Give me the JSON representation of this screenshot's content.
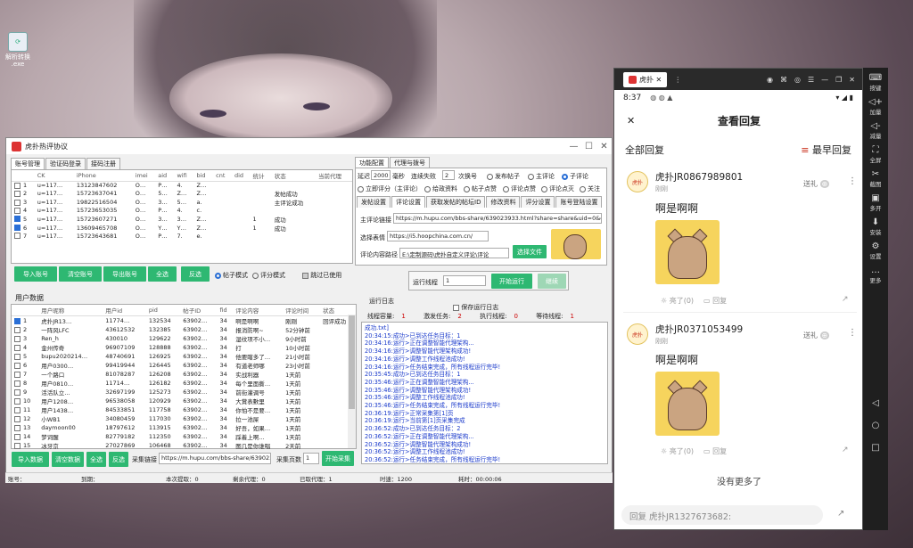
{
  "desktop": {
    "icon_label": "解析转换\n.exe"
  },
  "window": {
    "title": "虎扑热评协议"
  },
  "account_tabs": [
    "账号管理",
    "验证码登录",
    "接码注册"
  ],
  "account_table": {
    "headers": [
      "",
      "CK",
      "iPhone",
      "imei",
      "aid",
      "wifi",
      "bid",
      "cnt",
      "did",
      "统计",
      "状态",
      "当前代理"
    ],
    "rows": [
      {
        "n": "1",
        "checked": false,
        "ck": "u=117…",
        "iphone": "13123847602",
        "imei": "O…",
        "aid": "P…",
        "wifi": "4.",
        "bid": "Z…",
        "cnt": "",
        "did": "",
        "stat": "",
        "status": ""
      },
      {
        "n": "2",
        "checked": false,
        "ck": "u=117…",
        "iphone": "15723637041",
        "imei": "O…",
        "aid": "5…",
        "wifi": "Z…",
        "bid": "Z…",
        "cnt": "",
        "did": "",
        "stat": "",
        "status": "发帖成功"
      },
      {
        "n": "3",
        "checked": false,
        "ck": "u=117…",
        "iphone": "19822516504",
        "imei": "O…",
        "aid": "3…",
        "wifi": "5…",
        "bid": "a.",
        "cnt": "",
        "did": "",
        "stat": "",
        "status": "主评论成功"
      },
      {
        "n": "4",
        "checked": false,
        "ck": "u=117…",
        "iphone": "15723653035",
        "imei": "O…",
        "aid": "P…",
        "wifi": "4.",
        "bid": "c.",
        "cnt": "",
        "did": "",
        "stat": "",
        "status": ""
      },
      {
        "n": "5",
        "checked": true,
        "ck": "u=117…",
        "iphone": "15723607271",
        "imei": "O…",
        "aid": "3…",
        "wifi": "3…",
        "bid": "Z…",
        "cnt": "",
        "did": "",
        "stat": "1",
        "status": "成功"
      },
      {
        "n": "6",
        "checked": true,
        "ck": "u=117…",
        "iphone": "13609465708",
        "imei": "O…",
        "aid": "Y…",
        "wifi": "Y…",
        "bid": "Z…",
        "cnt": "",
        "did": "",
        "stat": "1",
        "status": "成功"
      },
      {
        "n": "7",
        "checked": false,
        "ck": "u=117…",
        "iphone": "15723643681",
        "imei": "O…",
        "aid": "P…",
        "wifi": "7.",
        "bid": "e.",
        "cnt": "",
        "did": "",
        "stat": "",
        "status": ""
      }
    ]
  },
  "account_buttons": {
    "import": "导入账号",
    "clear": "清空账号",
    "export": "导出账号",
    "select_all": "全选",
    "invert": "反选"
  },
  "mode": {
    "post": "帖子模式",
    "comment": "评分模式",
    "skip": "跳过已使用"
  },
  "user_section_title": "用户数据",
  "user_table": {
    "headers": [
      "",
      "用户昵称",
      "用户id",
      "pid",
      "帖子ID",
      "fid",
      "评论内容",
      "评论时间",
      "状态"
    ],
    "rows": [
      {
        "n": "1",
        "checked": true,
        "name": "虎扑JR13…",
        "uid": "11774…",
        "pid": "132534",
        "tid": "63902…",
        "fid": "34",
        "content": "啊是啊啊",
        "time": "刚刚",
        "status": "回评成功"
      },
      {
        "n": "2",
        "checked": false,
        "name": "一阵风LFC",
        "uid": "43612532",
        "pid": "132385",
        "tid": "63902…",
        "fid": "34",
        "content": "报消防啊~",
        "time": "52分钟前",
        "status": ""
      },
      {
        "n": "3",
        "checked": false,
        "name": "Ren_h",
        "uid": "430010",
        "pid": "129622",
        "tid": "63902…",
        "fid": "34",
        "content": "湿纹项不小…",
        "time": "9小时前",
        "status": ""
      },
      {
        "n": "4",
        "checked": false,
        "name": "金州传奇",
        "uid": "96907109",
        "pid": "128888",
        "tid": "63902…",
        "fid": "34",
        "content": "打",
        "time": "10小时前",
        "status": ""
      },
      {
        "n": "5",
        "checked": false,
        "name": "bupu2020214…",
        "uid": "48740691",
        "pid": "126925",
        "tid": "63902…",
        "fid": "34",
        "content": "他要瞎多了…",
        "time": "21小时前",
        "status": ""
      },
      {
        "n": "6",
        "checked": false,
        "name": "用户0300…",
        "uid": "99419944",
        "pid": "126445",
        "tid": "63902…",
        "fid": "34",
        "content": "有道老师哪",
        "time": "23小时前",
        "status": ""
      },
      {
        "n": "7",
        "checked": false,
        "name": "一个路口",
        "uid": "81078287",
        "pid": "126208",
        "tid": "63902…",
        "fid": "34",
        "content": "实战利器",
        "time": "1天前",
        "status": ""
      },
      {
        "n": "8",
        "checked": false,
        "name": "用户0810…",
        "uid": "11714…",
        "pid": "126182",
        "tid": "63902…",
        "fid": "34",
        "content": "每个里面撕…",
        "time": "1天前",
        "status": ""
      },
      {
        "n": "9",
        "checked": false,
        "name": "活活队立…",
        "uid": "32697199",
        "pid": "125273",
        "tid": "63902…",
        "fid": "34",
        "content": "前街灌调号",
        "time": "1天前",
        "status": ""
      },
      {
        "n": "10",
        "checked": false,
        "name": "用户1208…",
        "uid": "96538058",
        "pid": "120929",
        "tid": "63902…",
        "fid": "34",
        "content": "大賞表數里",
        "time": "1天前",
        "status": ""
      },
      {
        "n": "11",
        "checked": false,
        "name": "用户1438…",
        "uid": "84533851",
        "pid": "117758",
        "tid": "63902…",
        "fid": "34",
        "content": "你怕不是要…",
        "time": "1天前",
        "status": ""
      },
      {
        "n": "12",
        "checked": false,
        "name": "小WB1",
        "uid": "34080459",
        "pid": "117030",
        "tid": "63902…",
        "fid": "34",
        "content": "拉一池屎",
        "time": "1天前",
        "status": ""
      },
      {
        "n": "13",
        "checked": false,
        "name": "daymoon00",
        "uid": "18797612",
        "pid": "113915",
        "tid": "63902…",
        "fid": "34",
        "content": "好吾，如果…",
        "time": "1天前",
        "status": ""
      },
      {
        "n": "14",
        "checked": false,
        "name": "梦词醒",
        "uid": "82779182",
        "pid": "112350",
        "tid": "63902…",
        "fid": "34",
        "content": "踩着上啊…",
        "time": "1天前",
        "status": ""
      },
      {
        "n": "15",
        "checked": false,
        "name": "冰牙京",
        "uid": "27027869",
        "pid": "106468",
        "tid": "63902…",
        "fid": "34",
        "content": "图几是你谁唱",
        "time": "2天前",
        "status": ""
      }
    ]
  },
  "user_buttons": {
    "import": "导入数据",
    "clear": "清空数据",
    "select_all": "全选",
    "invert": "反选",
    "collect": "开始采集"
  },
  "collect": {
    "link_label": "采集链接",
    "link_value": "https://m.hupu.com/bbs-share/639023",
    "pages_label": "采集页数",
    "pages_value": "1"
  },
  "func_tabs": [
    "功能配置",
    "代理与拨号"
  ],
  "config": {
    "delay_label": "延迟",
    "delay_value": "2000",
    "ms": "毫秒",
    "fail_label": "连续失败",
    "fail_value": "2",
    "times_label": "次换号",
    "opt_post": "发布帖子",
    "opt_main": "主评论",
    "opt_sub": "子评论",
    "opt_rate": "立即评分（主评论）",
    "opt_follow_res": "给政资料",
    "opt_like_post": "帖子点赞",
    "opt_like_cmt": "评论点赞",
    "opt_dislike": "评论点灭",
    "opt_attention": "关注"
  },
  "sub_tabs": [
    "发帖设置",
    "评论设置",
    "获取发帖的帖坛ID",
    "修改资料",
    "评分设置",
    "账号登陆设置"
  ],
  "comment_settings": {
    "link_label": "主评论链接",
    "link_value": "https://m.hupu.com/bbs-share/639023933.html?share=share&uid=0&cli",
    "emoji_label": "选择表情",
    "emoji_value": "https://i5.hoopchina.com.cn/",
    "path_label": "评论内容路径",
    "path_value": "E:\\定制源码\\虎扑自定义评论\\评论",
    "file_btn": "选择文件"
  },
  "run": {
    "threads_label": "运行线程",
    "threads_value": "1",
    "start": "开始运行",
    "resume": "继续"
  },
  "log": {
    "title": "运行日志",
    "save_label": "保存运行日志",
    "stats": {
      "capacity_label": "线程容量:",
      "capacity": "1",
      "trigger_label": "激发任务:",
      "trigger": "2",
      "exec_label": "执行线程:",
      "exec": "0",
      "wait_label": "等待线程:",
      "wait": "1"
    },
    "lines": [
      "成功.txt]",
      "20:34:15:成功>已到达任务目标：1",
      "20:34:16:运行>正在调整智能代理架构...",
      "20:34:16:运行>调整智能代理架构成功!",
      "20:34:16:运行>调整工作线程池成功!",
      "20:34:16:运行>任务结束完成，所有线程运行完毕!",
      "20:35:45:成功>已到达任务目标：1",
      "20:35:46:运行>正在调整智能代理架构...",
      "20:35:46:运行>调整智能代理架构成功!",
      "20:35:46:运行>调整工作线程池成功!",
      "20:35:46:运行>任务结束完成，所有线程运行完毕!",
      "20:36:19:运行>正常采集第[1]页",
      "20:36:19:运行>当前第[1]页采集完成",
      "20:36:52:成功>已到达任务目标：2",
      "20:36:52:运行>正在调整智能代理架构...",
      "20:36:52:运行>调整智能代理架构成功!",
      "20:36:52:运行>调整工作线程池成功!",
      "20:36:52:运行>任务结束完成，所有线程运行完毕!"
    ]
  },
  "statusbar": {
    "account": "账号：",
    "expire": "到期：",
    "extract": "本次提取：0",
    "remaining_proxy": "剩余代理：0",
    "used_proxy": "已取代理：1",
    "time": "时速：1200",
    "elapsed": "耗时：00:00:06"
  },
  "emulator": {
    "tab_label": "虎扑",
    "status_time": "8:37",
    "sidebar": [
      "按键",
      "加量",
      "减量",
      "全屏",
      "截图",
      "多开",
      "安装",
      "设置",
      "更多"
    ]
  },
  "phone": {
    "header_title": "查看回复",
    "all_replies": "全部回复",
    "sort": "最早回复",
    "comments": [
      {
        "user": "虎扑JR0867989801",
        "time": "刚刚",
        "text": "啊是啊啊",
        "gift": "送礼",
        "light": "亮了(0)",
        "reply": "回复"
      },
      {
        "user": "虎扑JR0371053499",
        "time": "刚刚",
        "text": "啊是啊啊",
        "gift": "送礼",
        "light": "亮了(0)",
        "reply": "回复"
      }
    ],
    "no_more": "没有更多了",
    "reply_placeholder": "回复 虎扑JR1327673682:"
  }
}
